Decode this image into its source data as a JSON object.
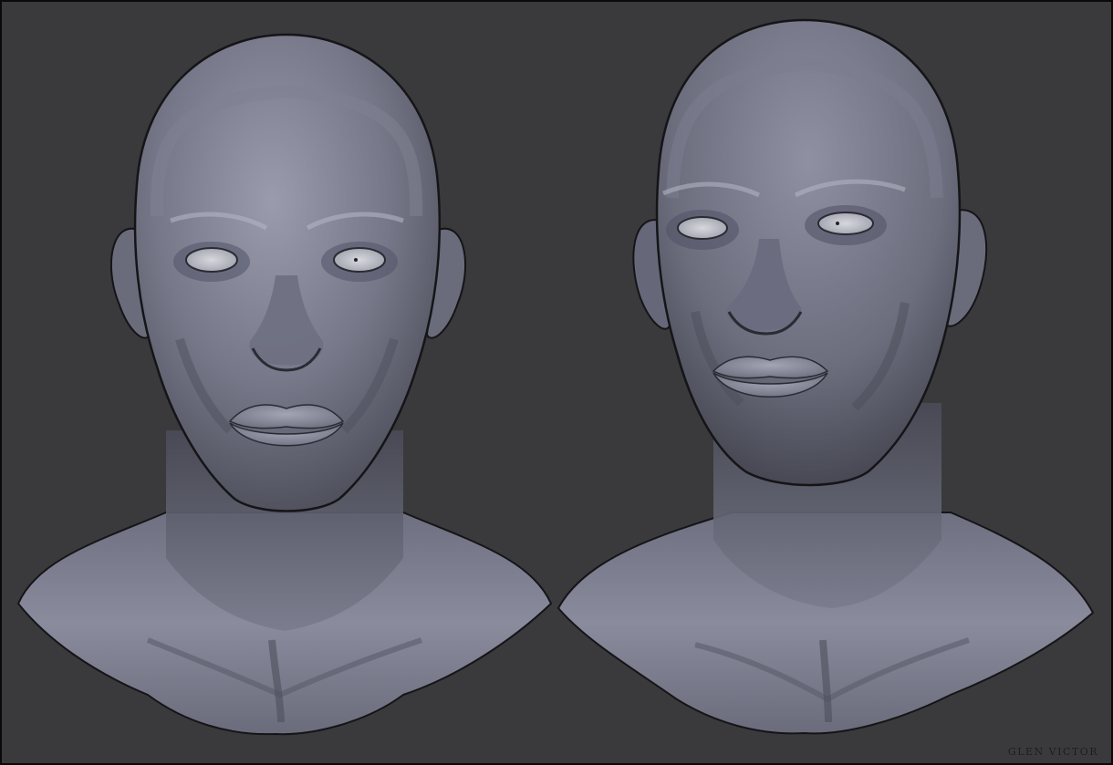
{
  "colors": {
    "background": "#3a3a3c",
    "skin_light": "#9a9cae",
    "skin_mid": "#6f7182",
    "skin_dark": "#3e3f48",
    "eye_white": "#c9cad2",
    "outline": "#151518"
  },
  "views": [
    {
      "name": "front-view"
    },
    {
      "name": "three-quarter-view"
    }
  ],
  "signature": "GLEN VICTOR"
}
